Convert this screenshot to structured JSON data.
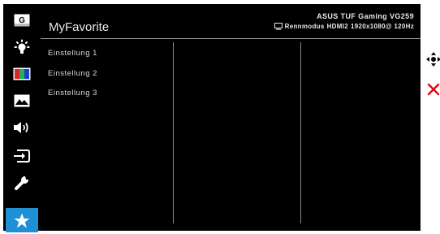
{
  "header": {
    "title": "MyFavorite",
    "model": "ASUS TUF Gaming VG259",
    "mode": "Rennmodus",
    "input": "HDMI2",
    "resolution": "1920x1080@ 120Hz"
  },
  "menu": {
    "items": [
      "Einstellung 1",
      "Einstellung 2",
      "Einstellung 3"
    ]
  },
  "sidebar": {
    "items": [
      "gaming-icon",
      "brightness-icon",
      "color-icon",
      "image-icon",
      "sound-icon",
      "input-select-icon",
      "system-setup-icon",
      "myfavorite-star-icon"
    ],
    "active": "myfavorite-star-icon"
  },
  "nav": {
    "items": [
      "move-navigate-icon",
      "close-icon"
    ]
  },
  "colors": {
    "background": "#000000",
    "accent": "#1f8fd6",
    "close": "#e60012"
  }
}
